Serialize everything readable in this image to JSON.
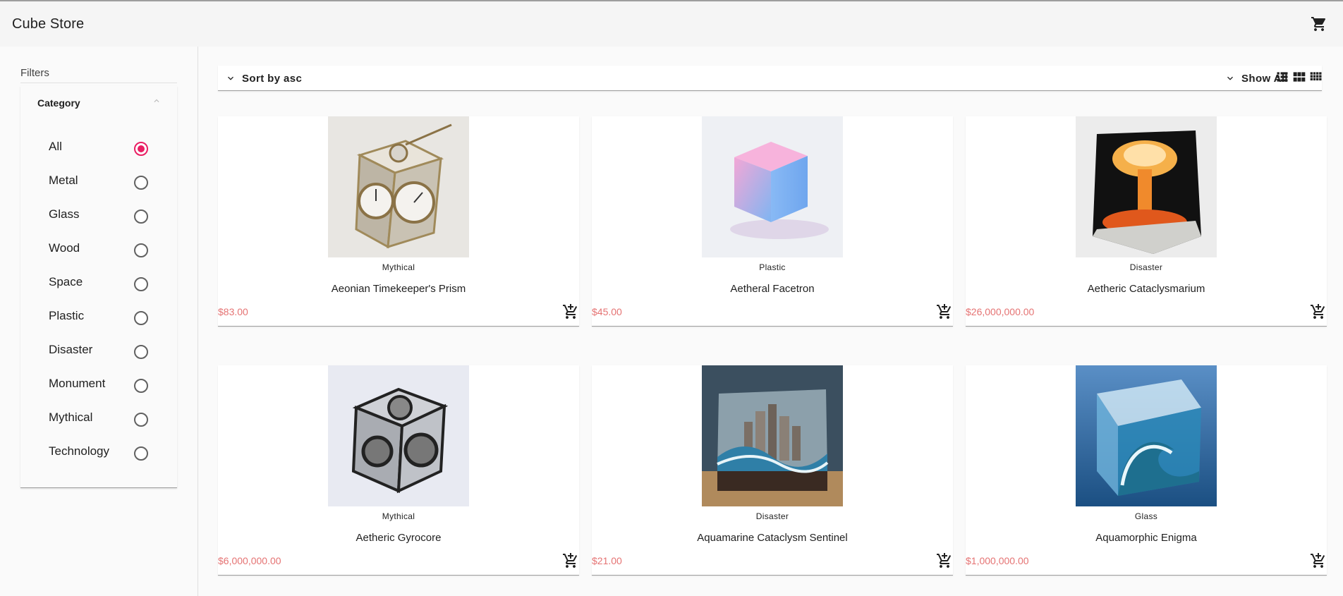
{
  "app": {
    "title": "Cube Store",
    "cart_icon": "cart-icon"
  },
  "sidebar": {
    "filters_label": "Filters",
    "category": {
      "label": "Category",
      "toggle_icon": "chevron-up-icon",
      "selected": "All",
      "options": [
        "All",
        "Metal",
        "Glass",
        "Wood",
        "Space",
        "Plastic",
        "Disaster",
        "Monument",
        "Mythical",
        "Technology"
      ]
    }
  },
  "toolbar": {
    "sort_label": "Sort by asc",
    "sort_icon": "chevron-down-icon",
    "show_label": "Show All",
    "show_icon": "chevron-down-icon",
    "view_icons": [
      "list-view-icon",
      "grid-view-icon",
      "compact-grid-view-icon"
    ]
  },
  "products": [
    {
      "category": "Mythical",
      "name": "Aeonian Timekeeper's Prism",
      "price": "$83.00",
      "image": "clockwork-cube-image"
    },
    {
      "category": "Plastic",
      "name": "Aetheral Facetron",
      "price": "$45.00",
      "image": "pastel-gradient-cube-image"
    },
    {
      "category": "Disaster",
      "name": "Aetheric Cataclysmarium",
      "price": "$26,000,000.00",
      "image": "mushroom-cloud-cube-image"
    },
    {
      "category": "Mythical",
      "name": "Aetheric Gyrocore",
      "price": "$6,000,000.00",
      "image": "chrome-gyro-cube-image"
    },
    {
      "category": "Disaster",
      "name": "Aquamarine Cataclysm Sentinel",
      "price": "$21.00",
      "image": "city-wave-cube-image"
    },
    {
      "category": "Glass",
      "name": "Aquamorphic Enigma",
      "price": "$1,000,000.00",
      "image": "glass-wave-cube-image"
    }
  ],
  "colors": {
    "accent": "#e91e63",
    "price": "#e57373",
    "topbar_bg": "#f5f5f5"
  }
}
